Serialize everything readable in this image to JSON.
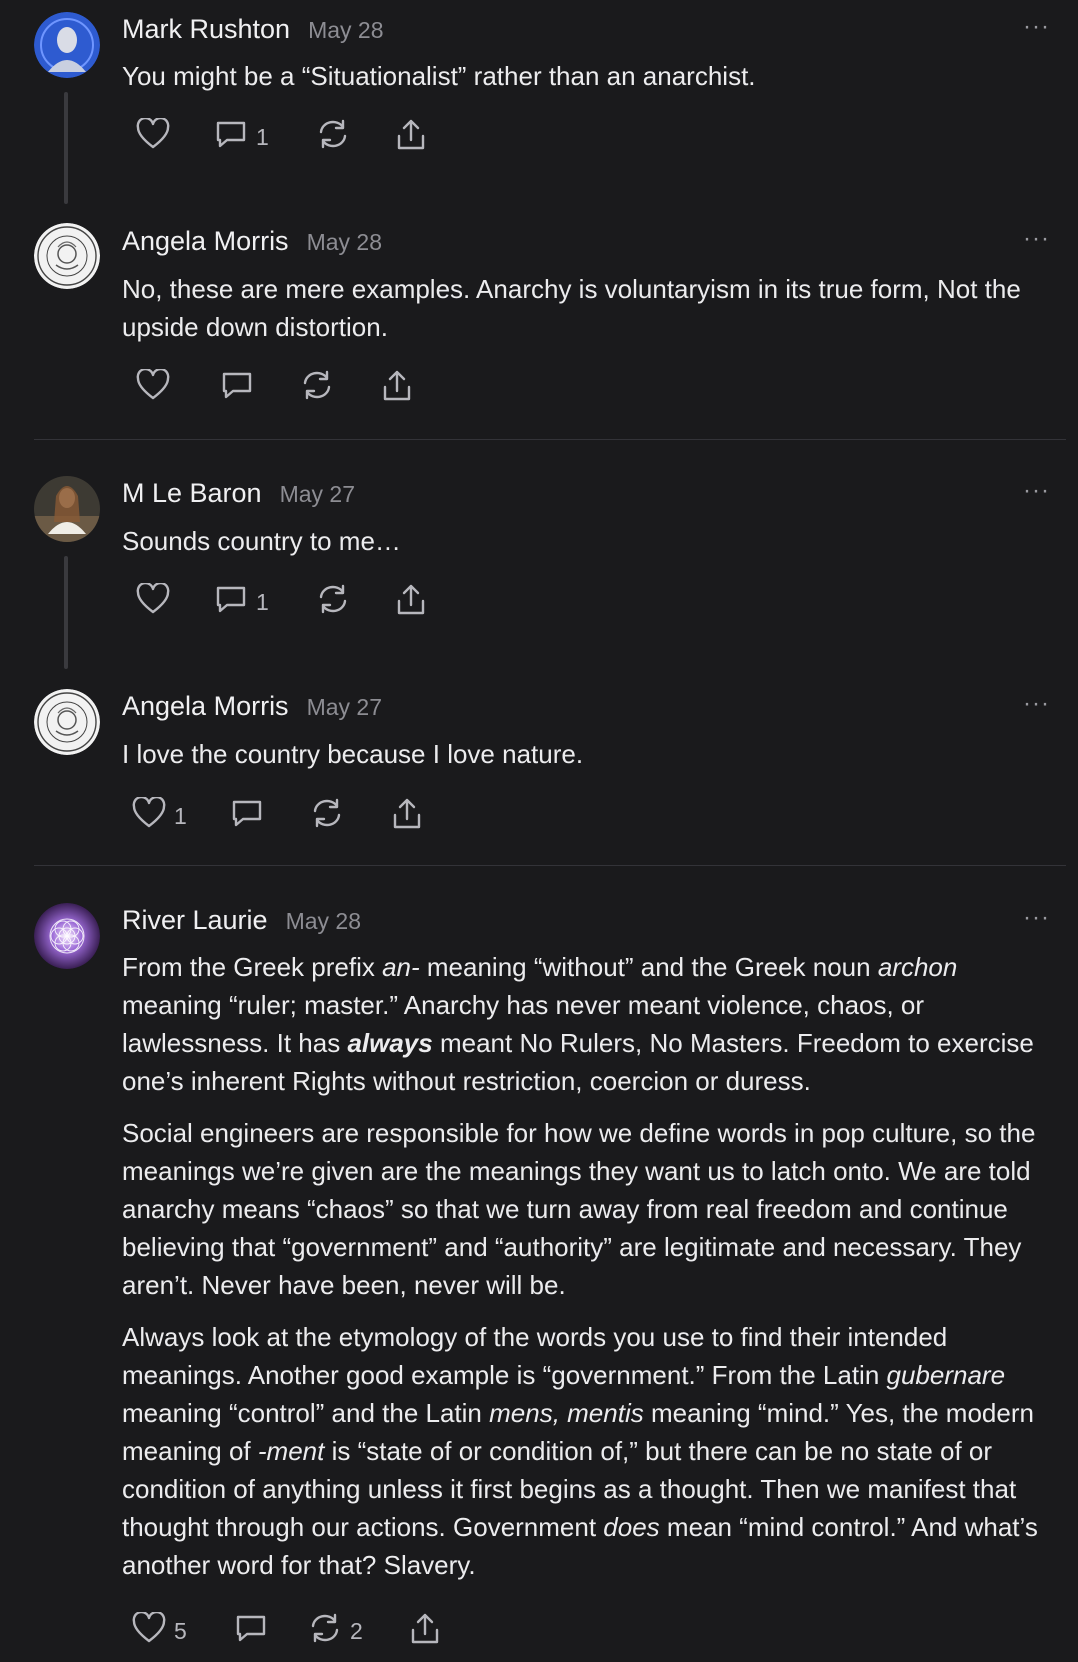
{
  "comments": [
    {
      "name": "Mark Rushton",
      "date": "May 28",
      "text": [
        "You might be a “Situationalist” rather than an anarchist."
      ],
      "likes": "",
      "replies": "1",
      "restacks": "",
      "avatar_icon": "portrait-icon"
    },
    {
      "name": "Angela Morris",
      "date": "May 28",
      "text": [
        "No, these are mere examples. Anarchy is voluntaryism in its true form, Not the upside down distortion."
      ],
      "likes": "",
      "replies": "",
      "restacks": "",
      "avatar_icon": "seal-icon"
    },
    {
      "name": "M Le Baron",
      "date": "May 27",
      "text": [
        "Sounds country to me…"
      ],
      "likes": "",
      "replies": "1",
      "restacks": "",
      "avatar_icon": "portrait-icon"
    },
    {
      "name": "Angela Morris",
      "date": "May 27",
      "text": [
        "I love the country because I love nature."
      ],
      "likes": "1",
      "replies": "",
      "restacks": "",
      "avatar_icon": "seal-icon"
    },
    {
      "name": "River Laurie",
      "date": "May 28",
      "paragraphs": [
        [
          {
            "t": "From the Greek prefix "
          },
          {
            "t": "an-",
            "s": "i"
          },
          {
            "t": " meaning “without” and the Greek noun "
          },
          {
            "t": "archon",
            "s": "i"
          },
          {
            "t": " meaning “ruler; master.” Anarchy has never meant violence, chaos, or lawlessness. It has "
          },
          {
            "t": "always",
            "s": "b"
          },
          {
            "t": " meant No Rulers, No Masters. Freedom to exercise one’s inherent Rights without restriction, coercion or duress."
          }
        ],
        [
          {
            "t": "Social engineers are responsible for how we define words in pop culture, so the meanings we’re given are the meanings they want us to latch onto. We are told anarchy means “chaos” so that we turn away from real freedom and continue believing that “government” and “authority” are legitimate and necessary. They aren’t. Never have been, never will be."
          }
        ],
        [
          {
            "t": "Always look at the etymology of the words you use to find their intended meanings. Another good example is “government.” From the Latin "
          },
          {
            "t": "gubernare",
            "s": "i"
          },
          {
            "t": " meaning “control” and the Latin "
          },
          {
            "t": "mens, mentis",
            "s": "i"
          },
          {
            "t": " meaning “mind.” Yes, the modern meaning of "
          },
          {
            "t": "-ment",
            "s": "i"
          },
          {
            "t": " is “state of or condition of,” but there can be no state of or condition of anything unless it first begins as a thought. Then we manifest that thought through our actions. Government "
          },
          {
            "t": "does",
            "s": "i"
          },
          {
            "t": " mean “mind control.” And what’s another word for that? Slavery."
          }
        ]
      ],
      "likes": "5",
      "replies": "",
      "restacks": "2",
      "avatar_icon": "flower-of-life-icon"
    }
  ],
  "more_label": "···",
  "icons": {
    "like": "heart-icon",
    "reply": "comment-bubble-icon",
    "restack": "restack-arrows-icon",
    "share": "share-upload-icon"
  },
  "colors": {
    "background": "#1a1a1c",
    "text": "#ececee",
    "muted": "#8d8d93"
  }
}
